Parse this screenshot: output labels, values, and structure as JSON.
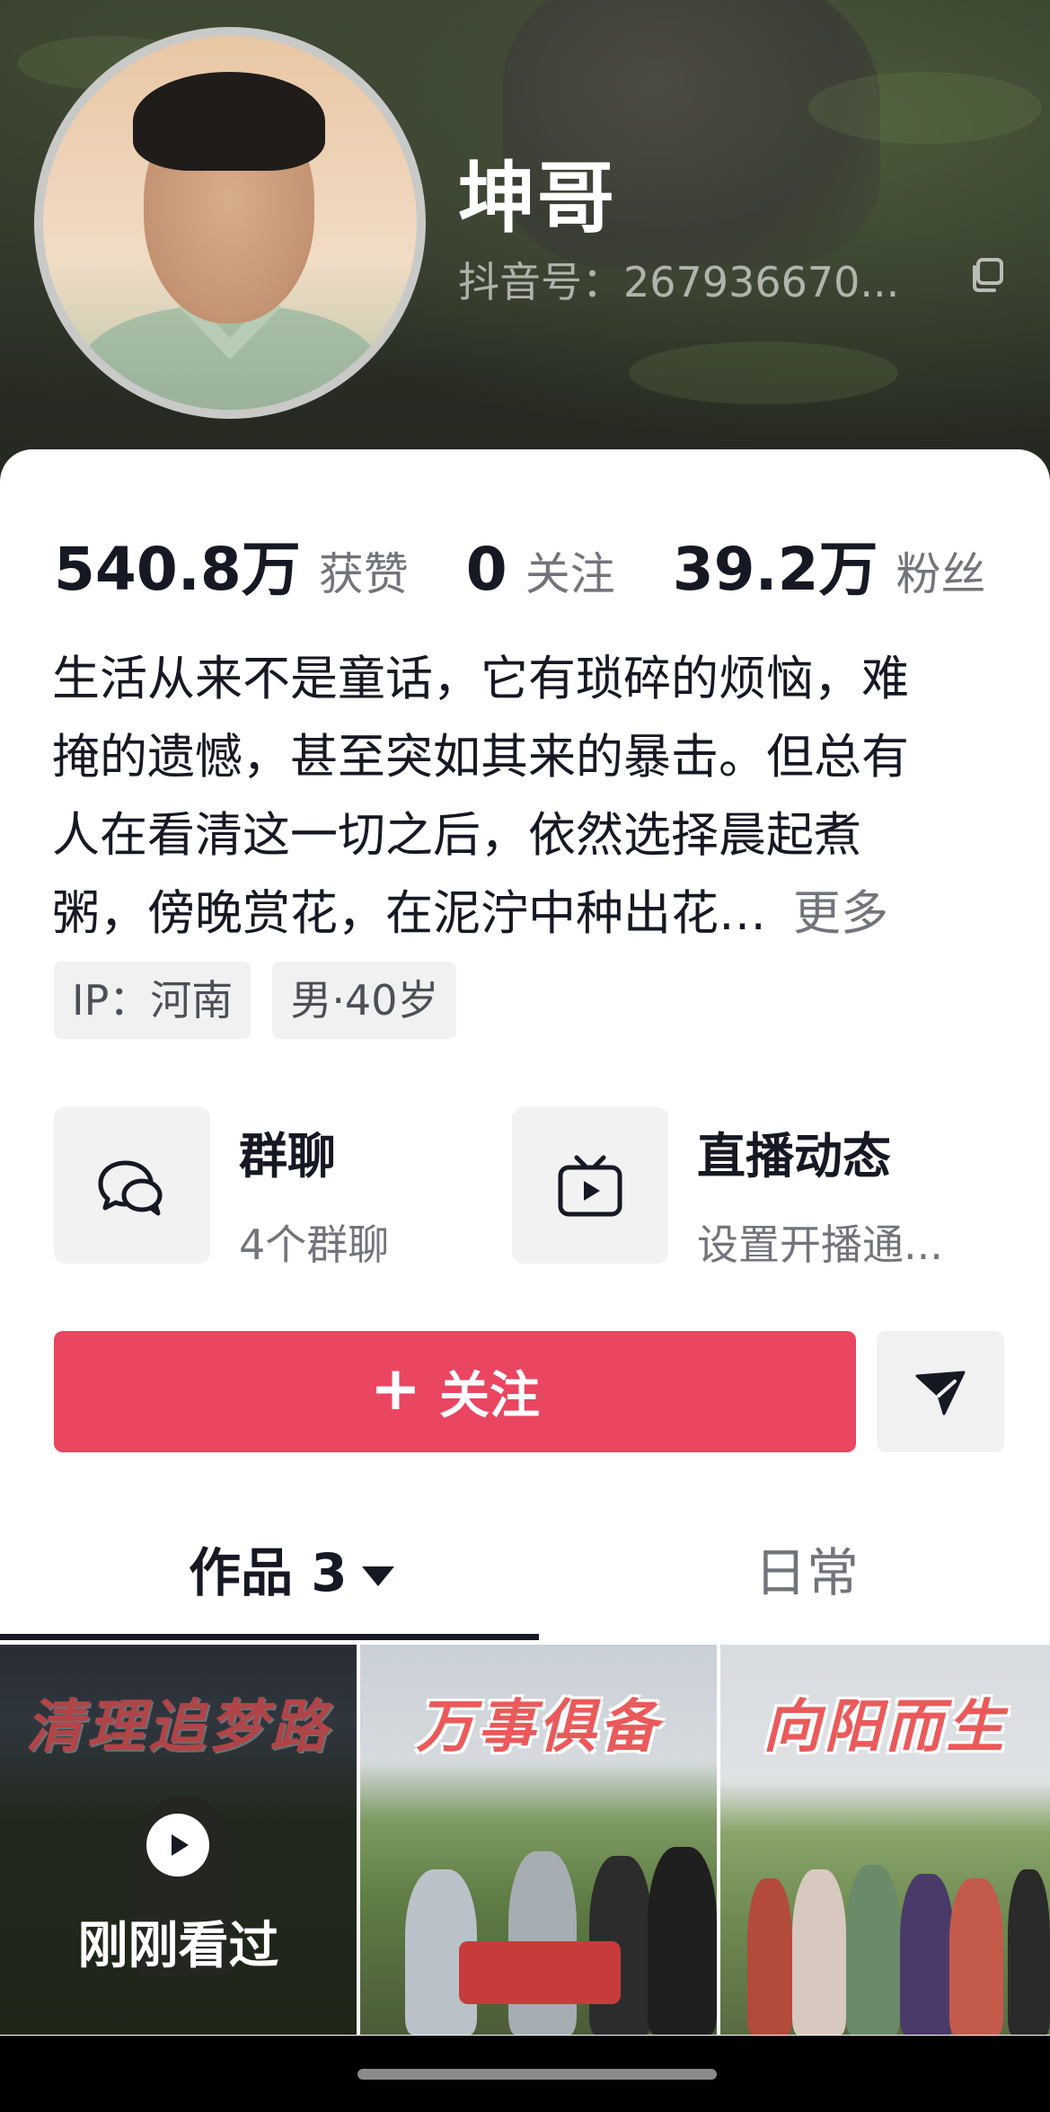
{
  "profile": {
    "name": "坤哥",
    "douyin_id": "抖音号：267936670..."
  },
  "stats": {
    "likes_value": "540.8万",
    "likes_label": "获赞",
    "following_value": "0",
    "following_label": "关注",
    "followers_value": "39.2万",
    "followers_label": "粉丝"
  },
  "bio": {
    "line1": "生活从来不是童话，它有琐碎的烦恼，难",
    "line2": "掩的遗憾，甚至突如其来的暴击。但总有",
    "line3": "人在看清这一切之后，依然选择晨起煮",
    "line4": "粥，傍晚赏花，在泥泞中种出花…",
    "more": "更多"
  },
  "tags": {
    "ip": "IP：河南",
    "gender_age": "男·40岁"
  },
  "features": {
    "group_chat_title": "群聊",
    "group_chat_sub": "4个群聊",
    "live_title": "直播动态",
    "live_sub": "设置开播通..."
  },
  "actions": {
    "follow_plus": "+",
    "follow_label": "关注"
  },
  "tabs": {
    "works_label": "作品 3",
    "daily_label": "日常"
  },
  "videos": [
    {
      "caption": "清理追梦路",
      "status": "刚刚看过"
    },
    {
      "caption": "万事俱备"
    },
    {
      "caption": "向阳而生"
    }
  ],
  "colors": {
    "follow_button": "#ea4561",
    "caption_text": "#ea5a5a"
  }
}
